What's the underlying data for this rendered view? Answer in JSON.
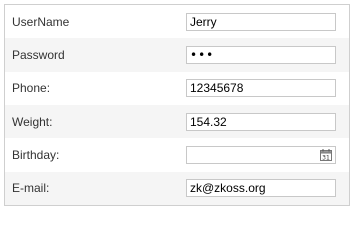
{
  "form": {
    "rows": [
      {
        "label": "UserName",
        "value": "Jerry"
      },
      {
        "label": "Password",
        "value": "•••"
      },
      {
        "label": "Phone:",
        "value": "12345678"
      },
      {
        "label": "Weight:",
        "value": "154.32"
      },
      {
        "label": "Birthday:",
        "value": ""
      },
      {
        "label": "E-mail:",
        "value": "zk@zkoss.org"
      }
    ]
  },
  "icons": {
    "calendar": "calendar-icon"
  },
  "colors": {
    "even_row_bg": "#f5f5f5",
    "border": "#cfcfcf",
    "input_border": "#c8c8c8"
  }
}
